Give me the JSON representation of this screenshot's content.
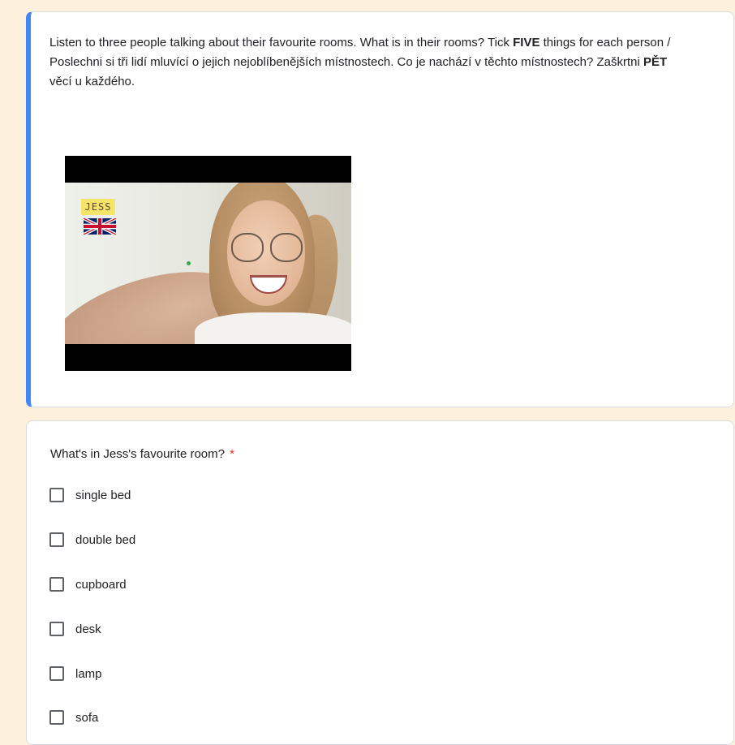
{
  "intro": {
    "part1": "Listen to three people talking about their favourite rooms. What is in their rooms? Tick ",
    "bold1": "FIVE",
    "part2": " things for each person / Poslechni si tři lidí mluvící o jejich nejoblíbenějších místnostech. Co je nachází v těchto místnostech? Zaškrtni ",
    "bold2": "PĚT",
    "part3": " věcí u každého."
  },
  "video": {
    "name_tag": "JESS",
    "flag_icon": "uk-flag-icon"
  },
  "question": {
    "title": "What's in Jess's favourite room?",
    "required_mark": "*",
    "options": [
      {
        "label": "single bed"
      },
      {
        "label": "double bed"
      },
      {
        "label": "cupboard"
      },
      {
        "label": "desk"
      },
      {
        "label": "lamp"
      },
      {
        "label": "sofa"
      }
    ]
  },
  "colors": {
    "page_background": "#fdf1de",
    "accent": "#4285f4",
    "required": "#d93025"
  }
}
